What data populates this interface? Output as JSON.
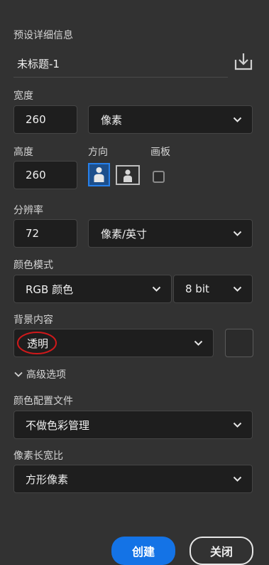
{
  "preset": {
    "section_label": "预设详细信息",
    "title_value": "未标题-1",
    "save_icon": "save-preset-icon"
  },
  "width": {
    "label": "宽度",
    "value": "260",
    "unit": "像素"
  },
  "height": {
    "label": "高度",
    "value": "260"
  },
  "orientation": {
    "label": "方向",
    "portrait_icon": "portrait-icon",
    "landscape_icon": "landscape-icon",
    "selected": "portrait"
  },
  "artboard": {
    "label": "画板",
    "checked": false
  },
  "resolution": {
    "label": "分辨率",
    "value": "72",
    "unit": "像素/英寸"
  },
  "color_mode": {
    "label": "颜色模式",
    "mode": "RGB 颜色",
    "depth": "8 bit"
  },
  "background": {
    "label": "背景内容",
    "value": "透明",
    "swatch_color": "#2b2b2b",
    "annotation_color": "#d0191b"
  },
  "advanced": {
    "label": "高级选项",
    "expanded": true
  },
  "color_profile": {
    "label": "颜色配置文件",
    "value": "不做色彩管理"
  },
  "pixel_aspect": {
    "label": "像素长宽比",
    "value": "方形像素"
  },
  "actions": {
    "create_label": "创建",
    "close_label": "关闭"
  },
  "colors": {
    "accent": "#1473e6",
    "panel": "#323232",
    "field": "#1e1e1e"
  }
}
